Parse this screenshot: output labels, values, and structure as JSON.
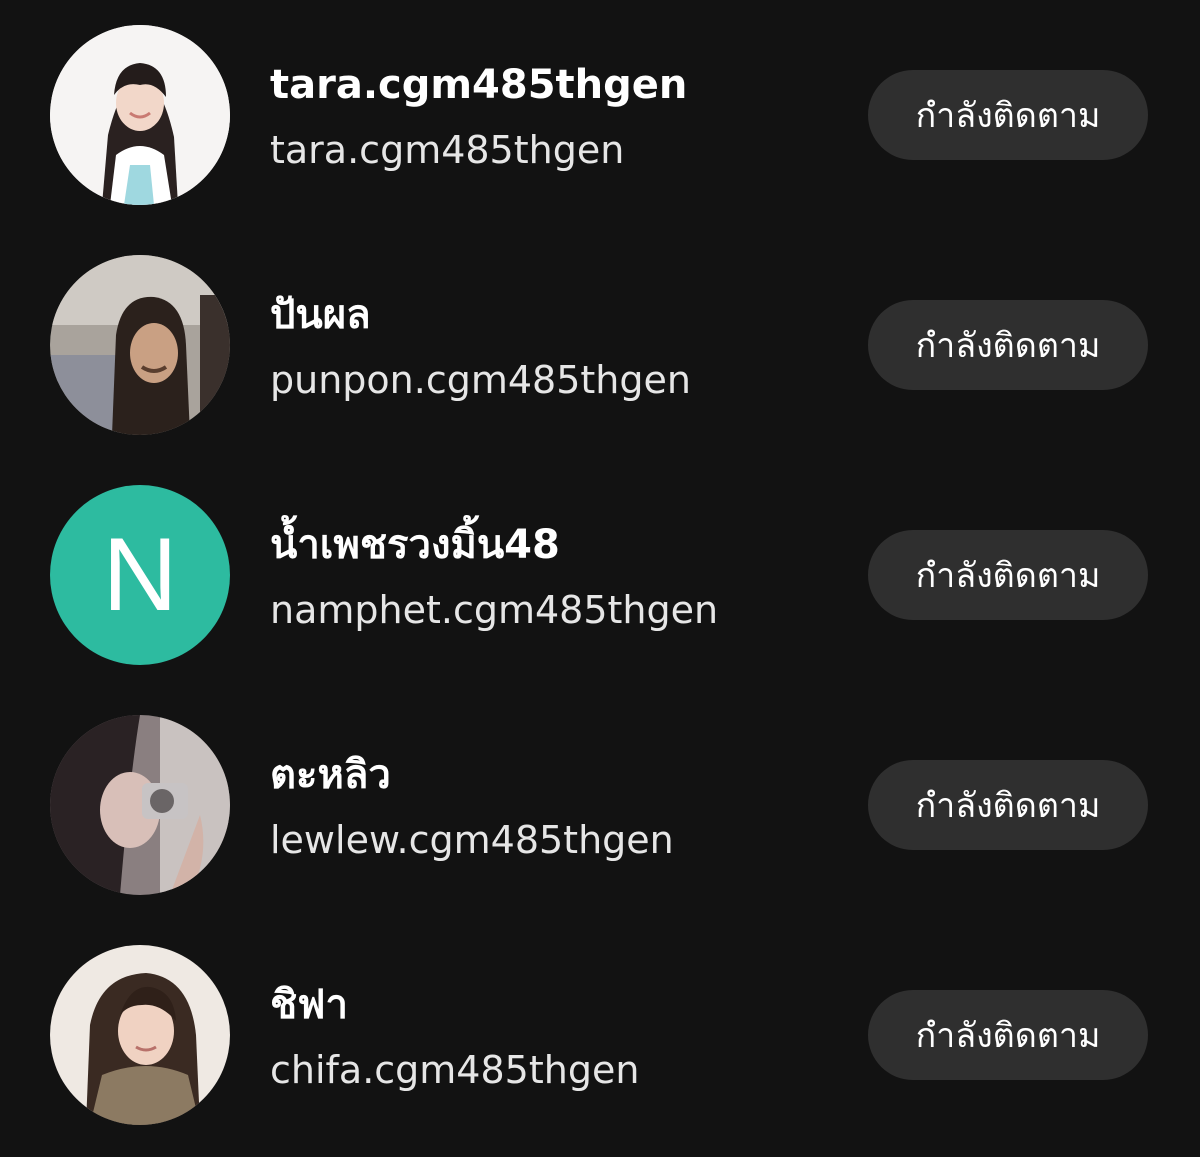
{
  "follow_list": [
    {
      "display_name": "tara.cgm485thgen",
      "username": "tara.cgm485thgen",
      "button_label": "กำลังติดตาม",
      "avatar": {
        "type": "photo"
      }
    },
    {
      "display_name": "ปันผล",
      "username": "punpon.cgm485thgen",
      "button_label": "กำลังติดตาม",
      "avatar": {
        "type": "photo"
      }
    },
    {
      "display_name": "น้ำเพชรวงมิ้น48",
      "username": "namphet.cgm485thgen",
      "button_label": "กำลังติดตาม",
      "avatar": {
        "type": "letter",
        "letter": "N",
        "color": "#2dbba0"
      }
    },
    {
      "display_name": "ตะหลิว",
      "username": "lewlew.cgm485thgen",
      "button_label": "กำลังติดตาม",
      "avatar": {
        "type": "photo"
      }
    },
    {
      "display_name": "ชิฟา",
      "username": "chifa.cgm485thgen",
      "button_label": "กำลังติดตาม",
      "avatar": {
        "type": "photo"
      }
    }
  ]
}
